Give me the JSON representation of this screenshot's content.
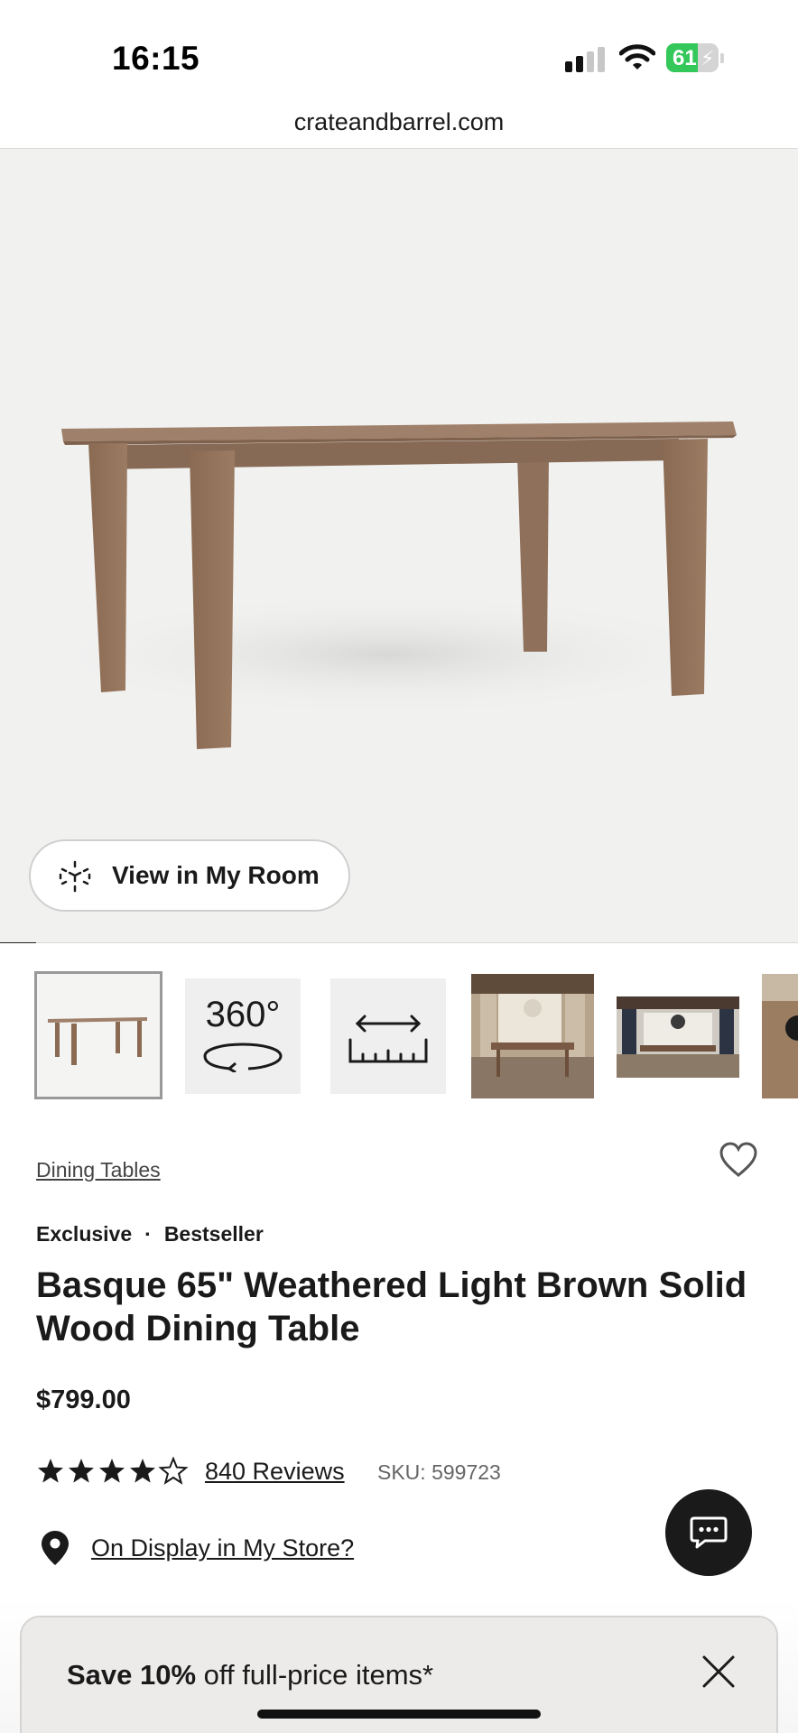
{
  "status_bar": {
    "time": "16:15",
    "battery_level": "61",
    "battery_fraction": 0.61,
    "battery_color": "#34c759",
    "icons": [
      "signal-icon",
      "wifi-icon",
      "battery-charging-icon"
    ]
  },
  "browser": {
    "url": "crateandbarrel.com"
  },
  "hero": {
    "view_in_room_label": "View in My Room",
    "view_in_room_icon": "ar-cube-icon",
    "carousel_progress": 0.045
  },
  "thumbnails": {
    "label_360": "360°",
    "items": [
      "table-photo",
      "360-view",
      "dimensions-ruler",
      "dining-room-photo",
      "dining-room-photo-2",
      "partial-photo"
    ]
  },
  "product": {
    "category_link": "Dining Tables",
    "badge_1": "Exclusive",
    "badge_separator": "·",
    "badge_2": "Bestseller",
    "title": "Basque 65\" Weathered Light Brown Solid Wood Dining Table",
    "price": "$799.00",
    "rating": 4.5,
    "reviews_link": "840 Reviews",
    "sku": "SKU: 599723",
    "store_link": "On Display in My Store?"
  },
  "promo": {
    "bold": "Save 10%",
    "text": " off full-price items*"
  },
  "colors": {
    "text": "#1a1a1a",
    "hero_background": "#f1f1f0",
    "promo_background": "#edebea",
    "chat_button": "#1a1a1a"
  }
}
